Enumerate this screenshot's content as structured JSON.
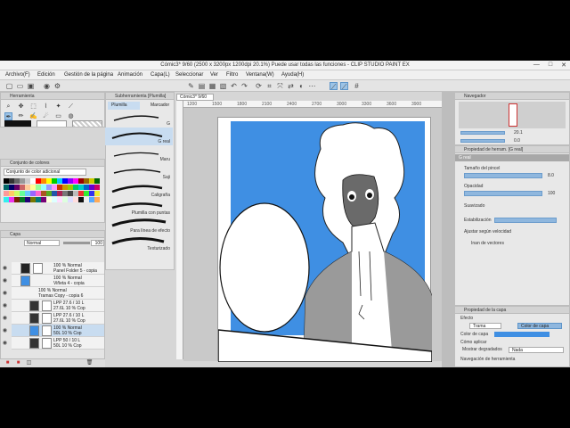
{
  "window": {
    "title": "Cómic3* 9/60 (2500 x 3200px 1200dpi 20.1%)  Puede usar todas las funciones - CLIP STUDIO PAINT EX",
    "controls": [
      "—",
      "□",
      "✕"
    ]
  },
  "menu": [
    "Archivo(F)",
    "Edición",
    "Gestión de la página",
    "Animación",
    "Capa(L)",
    "Seleccionar",
    "Ver",
    "Filtro",
    "Ventana(W)",
    "Ayuda(H)"
  ],
  "tool_panel": {
    "title": "Herramienta"
  },
  "subtool_panel": {
    "title": "Subherramienta [Plumilla]",
    "tabs": [
      "Plumilla",
      "Marcador"
    ],
    "brushes": [
      "G",
      "G real",
      "Maru",
      "Saji",
      "Caligrafía",
      "Plumilla con puntas",
      "Para línea de efecto",
      "Texturizado"
    ]
  },
  "color_set_panel": {
    "title": "Conjunto de colores",
    "dropdown": "Conjunto de color adicional"
  },
  "layer_panel": {
    "title": "Capa",
    "blend": "Normal",
    "opacity": "100",
    "layers": [
      {
        "l1": "100 % Normal",
        "l2": "Panel Folder 5 - copia"
      },
      {
        "l1": "100 % Normal",
        "l2": "Viñeta 4 - copia"
      },
      {
        "l1": "100 % Normal",
        "l2": "Tramas Copy - copia 6"
      },
      {
        "l1": "LPP 27.6 / 10 L",
        "l2": "27.6L 10 % Cop"
      },
      {
        "l1": "LPP 27.6 / 10 L",
        "l2": "27.6L 10 % Cop"
      },
      {
        "l1": "100 % Normal",
        "l2": "50L 10 % Cop"
      },
      {
        "l1": "LPP 50 / 10 L",
        "l2": "50L 10 % Cop"
      }
    ]
  },
  "canvas_tab": {
    "label": "Cómic3* 9/60"
  },
  "ruler": {
    "h": [
      "1200",
      "1500",
      "1800",
      "2100",
      "2400",
      "2700",
      "3000",
      "3300",
      "3600",
      "3900"
    ],
    "v": [
      "100",
      "300",
      "500",
      "700"
    ]
  },
  "navigator": {
    "title": "Navegador",
    "zoom": "20.1",
    "rotation": "0.0"
  },
  "tool_property": {
    "title": "Propiedad de herram. [G real]",
    "name": "G real",
    "brush_size_label": "Tamaño del pincel",
    "brush_size": "8.0",
    "opacity_label": "Opacidad",
    "opacity": "100",
    "anti_alias_label": "Suavizado",
    "stabilization_label": "Estabilización",
    "speed_label": "Ajustar según velocidad",
    "vector_label": "Inan de vectores"
  },
  "layer_property": {
    "title": "Propiedad de la capa",
    "effect_label": "Efecto",
    "trama_btn": "Trama",
    "color_capa_btn": "Color de capa",
    "layer_color_label": "Color de capa",
    "expression_color_label": "Cómo aplicar",
    "show_gradient_label": "Mostrar degradados",
    "show_gradient_value": "Nada",
    "nav_tool_label": "Navegación de herramienta"
  },
  "colors": {
    "accent": "#5e95c9",
    "sky": "#3f8fe3",
    "bg": "#d6d6d6"
  }
}
